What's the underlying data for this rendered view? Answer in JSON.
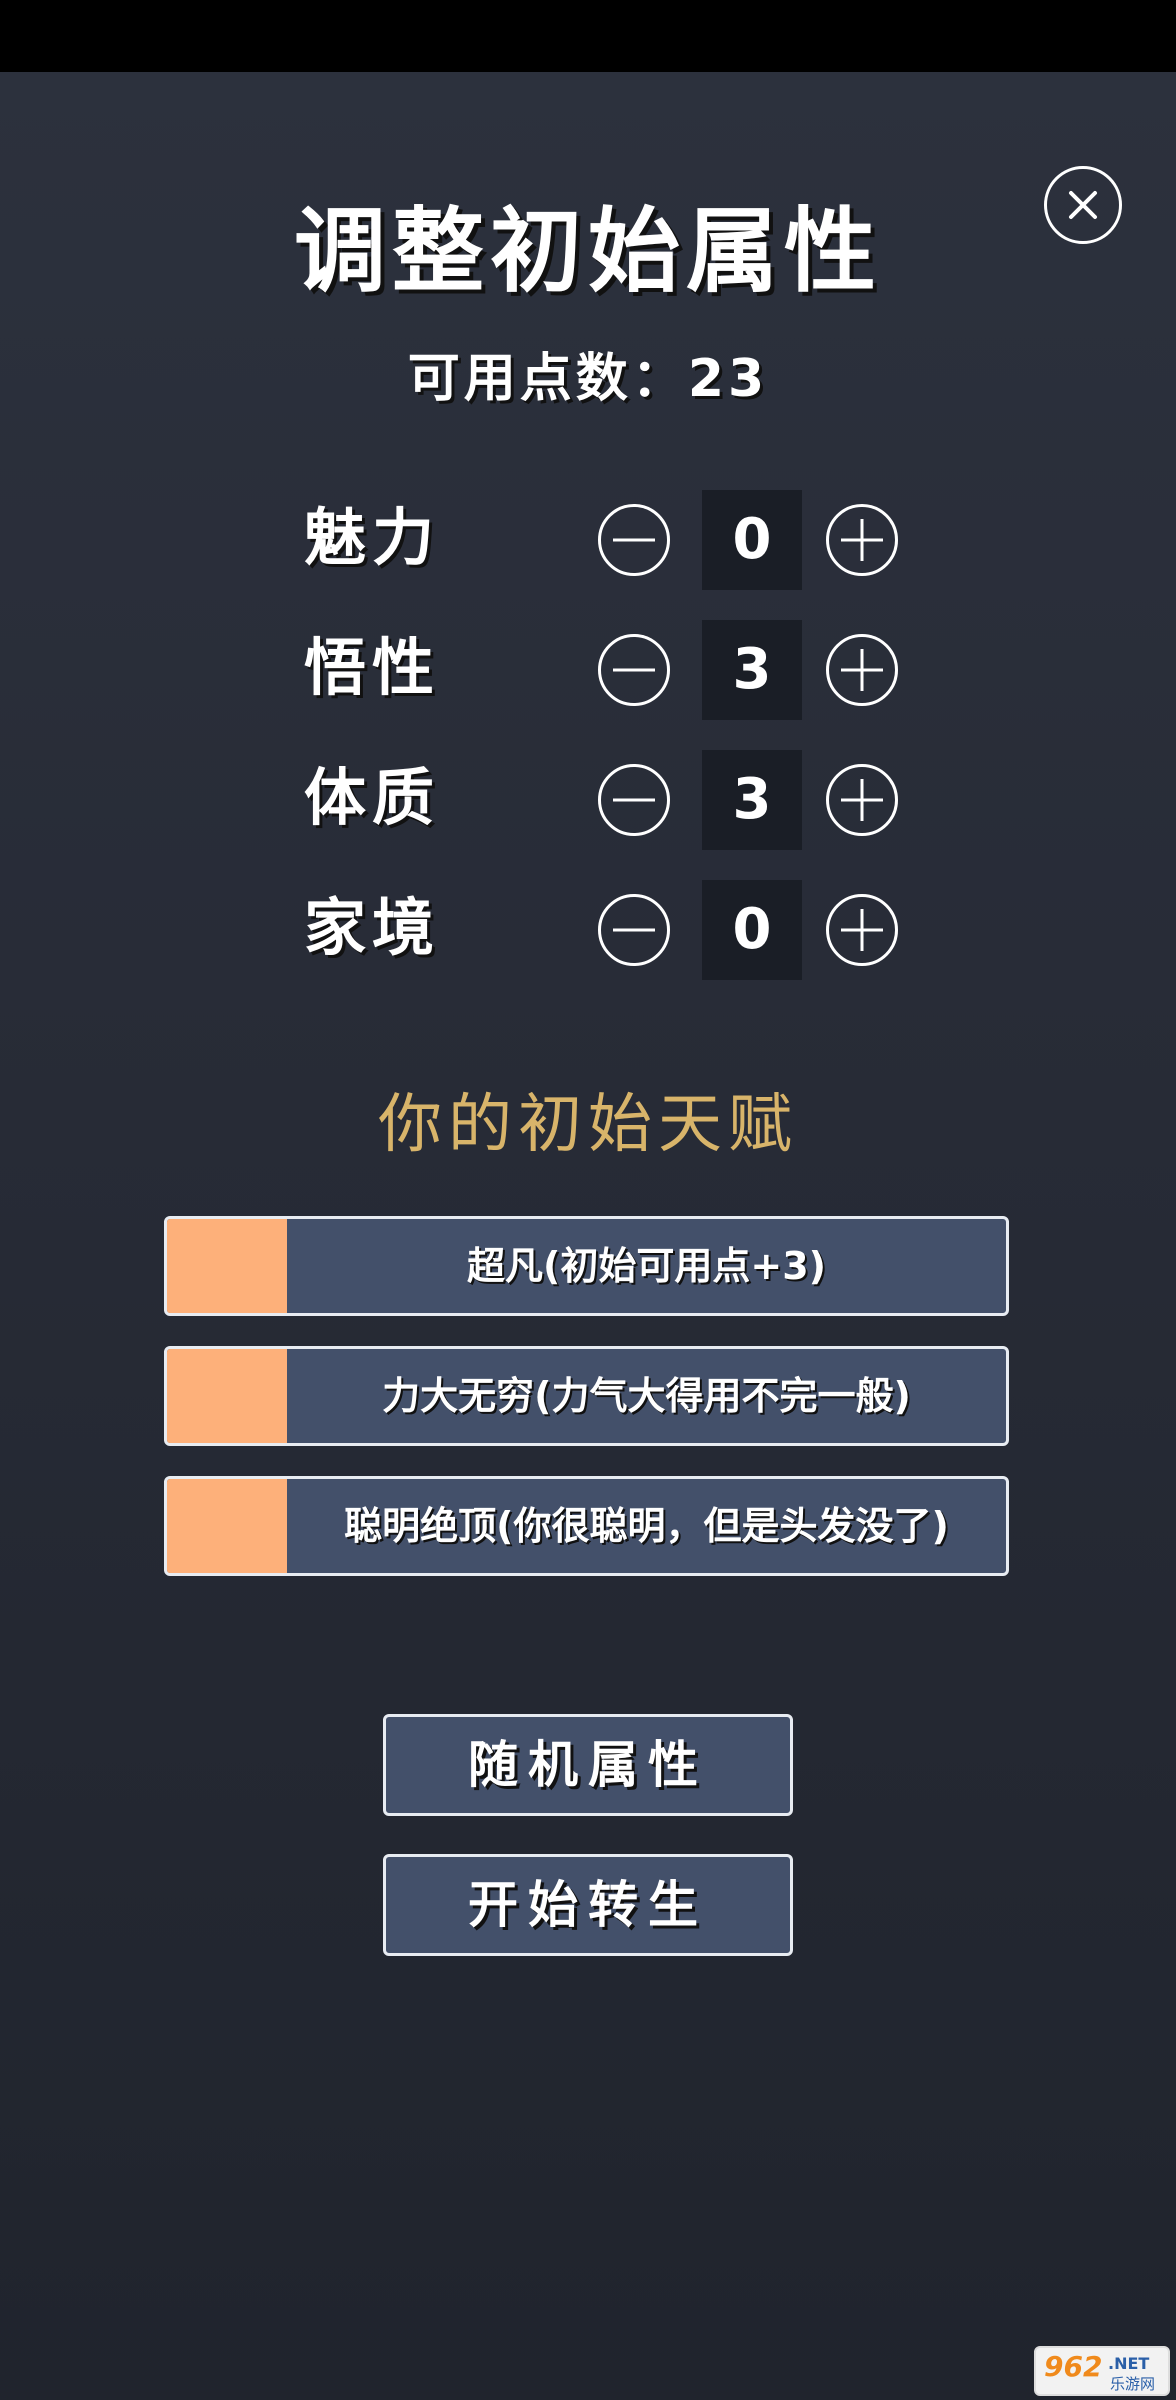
{
  "header": {
    "title": "调整初始属性",
    "points_label": "可用点数：",
    "points_value": "23",
    "close_icon": "close-icon"
  },
  "attributes": [
    {
      "label": "魅力",
      "value": "0"
    },
    {
      "label": "悟性",
      "value": "3"
    },
    {
      "label": "体质",
      "value": "3"
    },
    {
      "label": "家境",
      "value": "0"
    }
  ],
  "talents": {
    "heading": "你的初始天赋",
    "items": [
      {
        "text": "超凡(初始可用点+3)",
        "color": "#fdb07a"
      },
      {
        "text": "力大无穷(力气大得用不完一般)",
        "color": "#fdb07a"
      },
      {
        "text": "聪明绝顶(你很聪明，但是头发没了)",
        "color": "#fdb07a"
      }
    ]
  },
  "actions": {
    "random": "随机属性",
    "start": "开始转生"
  },
  "watermark": {
    "number": "962",
    "suffix": ".NET",
    "site": "乐游网"
  },
  "colors": {
    "background": "#272b36",
    "accent_gold": "#d8b46a",
    "button_fill": "#43506a",
    "talent_swatch": "#fdb07a"
  }
}
